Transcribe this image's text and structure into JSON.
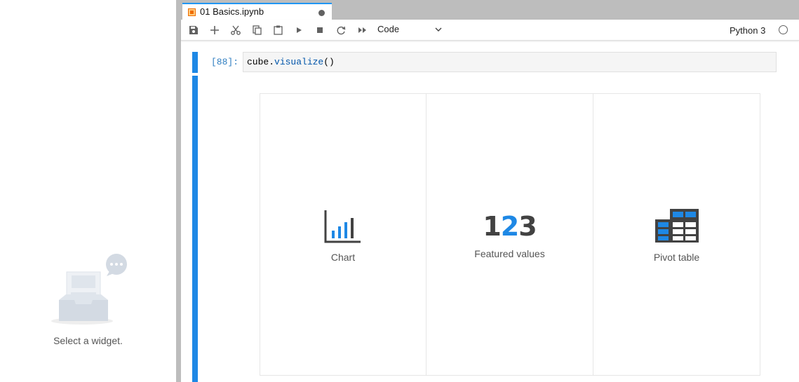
{
  "sidebar": {
    "empty_message": "Select a widget."
  },
  "tab": {
    "title": "01 Basics.ipynb"
  },
  "toolbar": {
    "cell_type": "Code",
    "kernel_name": "Python 3",
    "icons": [
      "save-icon",
      "add-icon",
      "cut-icon",
      "copy-icon",
      "paste-icon",
      "run-icon",
      "stop-icon",
      "restart-icon",
      "fast-forward-icon"
    ]
  },
  "cell": {
    "prompt": "[88]:",
    "code_obj": "cube.",
    "code_fn": "visualize",
    "code_args": "()"
  },
  "widget_choices": [
    {
      "label": "Chart",
      "icon": "chart-icon"
    },
    {
      "label": "Featured values",
      "icon": "featured-values-icon",
      "digits": [
        "1",
        "2",
        "3"
      ]
    },
    {
      "label": "Pivot table",
      "icon": "pivot-table-icon"
    }
  ],
  "colors": {
    "accent": "#1e88e5",
    "icon_dark": "#424242",
    "tab_marker": "#ef6c00"
  }
}
